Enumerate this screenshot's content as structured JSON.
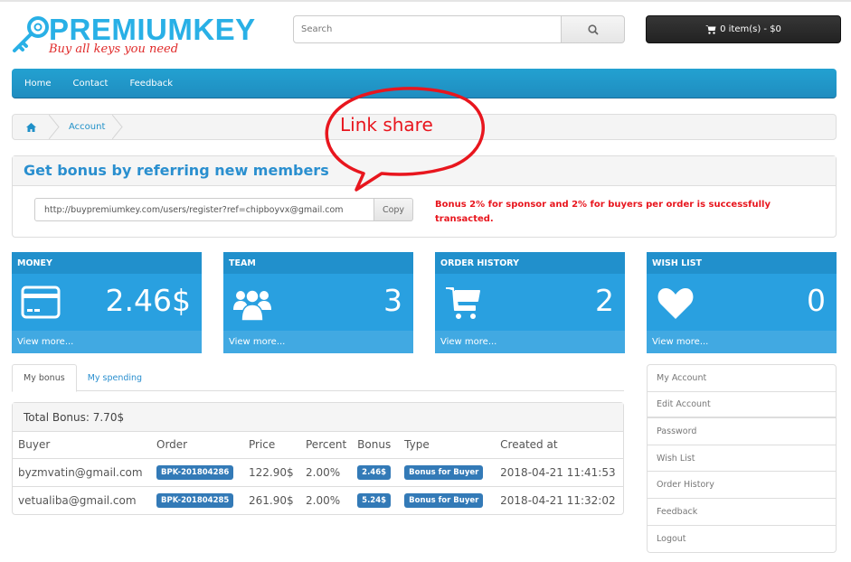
{
  "brand": {
    "name": "PREMIUMKEY",
    "tagline": "Buy all keys you need"
  },
  "search": {
    "placeholder": "Search",
    "icon": "search-icon"
  },
  "cart": {
    "icon": "shopping-cart-icon",
    "label": "0 item(s) - $0"
  },
  "nav": {
    "items": [
      "Home",
      "Contact",
      "Feedback"
    ]
  },
  "breadcrumb": {
    "home_icon": "home-icon",
    "items": [
      "Account"
    ]
  },
  "annotation": {
    "text": "Link share",
    "color": "#e8161e"
  },
  "referral": {
    "title": "Get bonus by referring new members",
    "link": "http://buypremiumkey.com/users/register?ref=chipboyvx@gmail.com",
    "copy_label": "Copy",
    "note": "Bonus 2% for sponsor and 2% for buyers per order is successfully transacted."
  },
  "cards": [
    {
      "title": "MONEY",
      "icon": "credit-card-icon",
      "value": "2.46$",
      "link": "View more..."
    },
    {
      "title": "TEAM",
      "icon": "users-icon",
      "value": "3",
      "link": "View more..."
    },
    {
      "title": "ORDER HISTORY",
      "icon": "shopping-cart-icon",
      "value": "2",
      "link": "View more..."
    },
    {
      "title": "WISH LIST",
      "icon": "heart-icon",
      "value": "0",
      "link": "View more..."
    }
  ],
  "tabs": [
    {
      "label": "My bonus",
      "active": true
    },
    {
      "label": "My spending",
      "active": false
    }
  ],
  "bonus": {
    "total_label": "Total Bonus: 7.70$",
    "columns": [
      "Buyer",
      "Order",
      "Price",
      "Percent",
      "Bonus",
      "Type",
      "Created at"
    ],
    "rows": [
      {
        "buyer": "byzmvatin@gmail.com",
        "order": "BPK-201804286",
        "price": "122.90$",
        "percent": "2.00%",
        "bonus": "2.46$",
        "type": "Bonus for Buyer",
        "created": "2018-04-21 11:41:53"
      },
      {
        "buyer": "vetualiba@gmail.com",
        "order": "BPK-201804285",
        "price": "261.90$",
        "percent": "2.00%",
        "bonus": "5.24$",
        "type": "Bonus for Buyer",
        "created": "2018-04-21 11:32:02"
      }
    ]
  },
  "sidebar": {
    "items": [
      "My Account",
      "Edit Account",
      "Password",
      "Wish List",
      "Order History",
      "Feedback",
      "Logout"
    ]
  },
  "colors": {
    "brand_blue": "#29b0e6",
    "nav_blue": "#1f8dc0",
    "card_blue": "#29a0e0",
    "label_blue": "#337ab7",
    "alert_red": "#e8161e"
  }
}
